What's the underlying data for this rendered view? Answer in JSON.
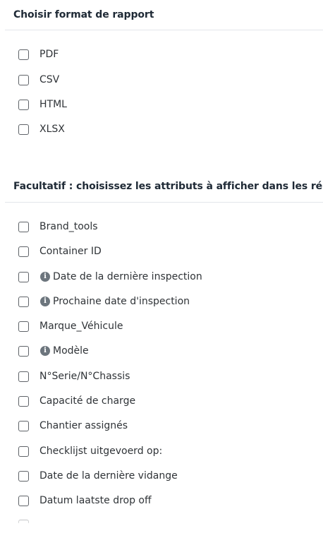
{
  "format_section": {
    "title": "Choisir format de rapport",
    "options": [
      {
        "label": "PDF",
        "checked": false
      },
      {
        "label": "CSV",
        "checked": false
      },
      {
        "label": "HTML",
        "checked": false
      },
      {
        "label": "XLSX",
        "checked": false
      }
    ]
  },
  "attributes_section": {
    "title": "Facultatif : choisissez les attributs à afficher dans les résumés",
    "options": [
      {
        "label": "Brand_tools",
        "info": false,
        "checked": false
      },
      {
        "label": "Container ID",
        "info": false,
        "checked": false
      },
      {
        "label": "Date de la dernière inspection",
        "info": true,
        "checked": false
      },
      {
        "label": "Prochaine date d'inspection",
        "info": true,
        "checked": false
      },
      {
        "label": "Marque_Véhicule",
        "info": false,
        "checked": false
      },
      {
        "label": "Modèle",
        "info": true,
        "checked": false
      },
      {
        "label": "N°Serie/N°Chassis",
        "info": false,
        "checked": false
      },
      {
        "label": "Capacité de charge",
        "info": false,
        "checked": false
      },
      {
        "label": "Chantier assignés",
        "info": false,
        "checked": false
      },
      {
        "label": "Checklijst uitgevoerd op:",
        "info": false,
        "checked": false
      },
      {
        "label": "Date de la dernière vidange",
        "info": false,
        "checked": false
      },
      {
        "label": "Datum laatste drop off",
        "info": false,
        "checked": false
      }
    ]
  },
  "icons": {
    "info": "info-circle-icon"
  },
  "colors": {
    "heading": "#1f2a36",
    "text": "#2f3337",
    "checkbox_border": "#5f6368",
    "info_icon": "#6c757d",
    "divider": "#e3e6ea"
  }
}
